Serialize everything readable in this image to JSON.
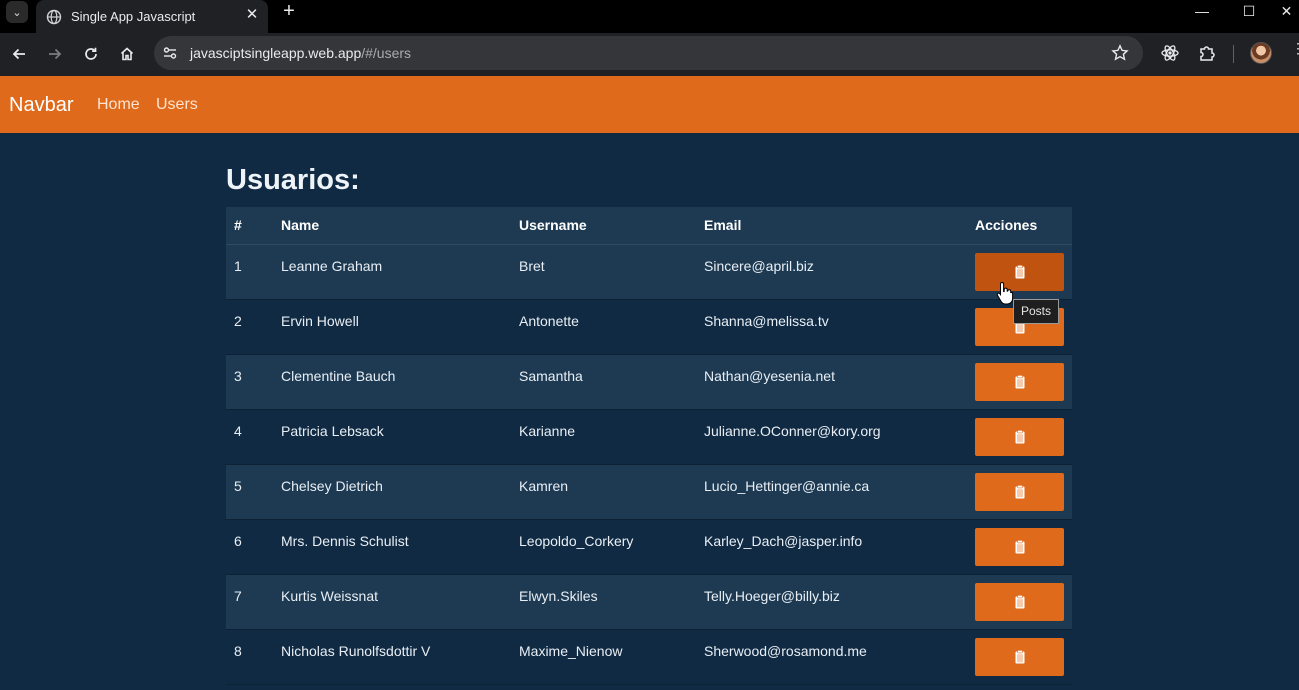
{
  "browser": {
    "tab_title": "Single App Javascript",
    "url_host": "javasciptsingleapp.web.app",
    "url_path": "/#/users"
  },
  "navbar": {
    "brand": "Navbar",
    "links": [
      "Home",
      "Users"
    ],
    "color": "#e06a1b"
  },
  "page": {
    "heading": "Usuarios:",
    "tooltip": "Posts"
  },
  "table": {
    "headers": [
      "#",
      "Name",
      "Username",
      "Email",
      "Acciones"
    ],
    "rows": [
      {
        "id": "1",
        "name": "Leanne Graham",
        "username": "Bret",
        "email": "Sincere@april.biz"
      },
      {
        "id": "2",
        "name": "Ervin Howell",
        "username": "Antonette",
        "email": "Shanna@melissa.tv"
      },
      {
        "id": "3",
        "name": "Clementine Bauch",
        "username": "Samantha",
        "email": "Nathan@yesenia.net"
      },
      {
        "id": "4",
        "name": "Patricia Lebsack",
        "username": "Karianne",
        "email": "Julianne.OConner@kory.org"
      },
      {
        "id": "5",
        "name": "Chelsey Dietrich",
        "username": "Kamren",
        "email": "Lucio_Hettinger@annie.ca"
      },
      {
        "id": "6",
        "name": "Mrs. Dennis Schulist",
        "username": "Leopoldo_Corkery",
        "email": "Karley_Dach@jasper.info"
      },
      {
        "id": "7",
        "name": "Kurtis Weissnat",
        "username": "Elwyn.Skiles",
        "email": "Telly.Hoeger@billy.biz"
      },
      {
        "id": "8",
        "name": "Nicholas Runolfsdottir V",
        "username": "Maxime_Nienow",
        "email": "Sherwood@rosamond.me"
      }
    ],
    "action_icon": "clipboard-icon"
  }
}
